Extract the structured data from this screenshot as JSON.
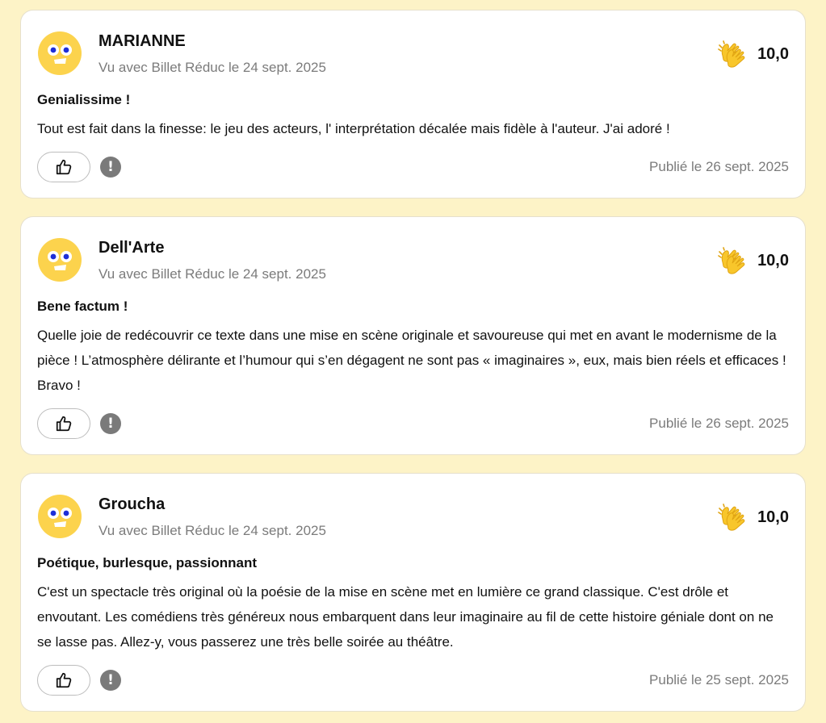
{
  "reviews": [
    {
      "author": "MARIANNE",
      "seen_with": "Vu avec Billet Réduc le 24 sept. 2025",
      "score": "10,0",
      "title": "Genialissime !",
      "body": "Tout est fait dans la finesse: le jeu des acteurs, l' interprétation décalée mais fidèle à l'auteur. J'ai adoré !",
      "published": "Publié le 26 sept. 2025"
    },
    {
      "author": "Dell'Arte",
      "seen_with": "Vu avec Billet Réduc le 24 sept. 2025",
      "score": "10,0",
      "title": "Bene factum !",
      "body": "Quelle joie de redécouvrir ce texte dans une mise en scène originale et savoureuse qui met en avant le modernisme de la pièce ! L’atmosphère délirante et l’humour qui s’en dégagent ne sont pas « imaginaires », eux, mais bien réels et efficaces ! Bravo !",
      "published": "Publié le 26 sept. 2025"
    },
    {
      "author": "Groucha",
      "seen_with": "Vu avec Billet Réduc le 24 sept. 2025",
      "score": "10,0",
      "title": "Poétique, burlesque, passionnant",
      "body": "C'est un spectacle très original où la poésie de la mise en scène met en lumière ce grand classique. C'est drôle et envoutant. Les comédiens très généreux nous embarquent dans leur imaginaire au fil de cette histoire géniale dont on ne se lasse pas. Allez-y, vous passerez une très belle soirée au théâtre.",
      "published": "Publié le 25 sept. 2025"
    }
  ],
  "report_glyph": "!",
  "icons": {
    "avatar": "smiley-avatar-icon",
    "score": "clapping-hands-icon",
    "like": "thumbs-up-icon",
    "report": "exclamation-icon"
  },
  "colors": {
    "page_background": "#FDF3C7",
    "card_background": "#FFFFFF",
    "avatar_yellow": "#FCD34D",
    "clap_yellow": "#F8C62B",
    "muted_text": "#7B7B7B"
  }
}
